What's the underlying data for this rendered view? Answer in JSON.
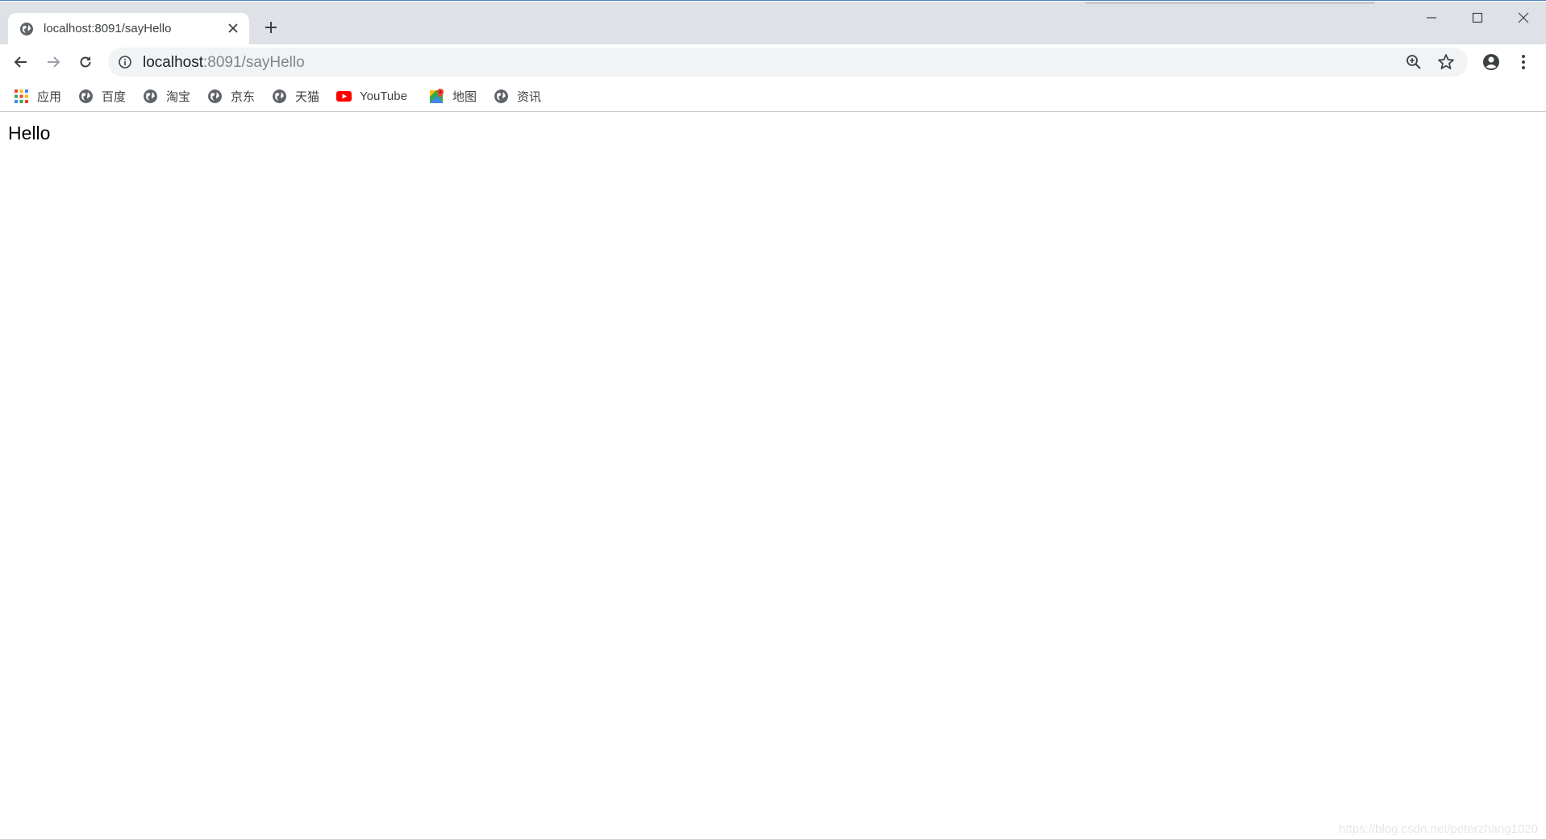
{
  "tab": {
    "title": "localhost:8091/sayHello",
    "favicon": "globe-icon"
  },
  "toolbar": {
    "url_host": "localhost",
    "url_path": ":8091/sayHello"
  },
  "bookmarks": [
    {
      "label": "应用",
      "icon": "apps-grid-icon"
    },
    {
      "label": "百度",
      "icon": "globe-icon"
    },
    {
      "label": "淘宝",
      "icon": "globe-icon"
    },
    {
      "label": "京东",
      "icon": "globe-icon"
    },
    {
      "label": "天猫",
      "icon": "globe-icon"
    },
    {
      "label": "YouTube",
      "icon": "youtube-icon"
    },
    {
      "label": "地图",
      "icon": "maps-icon"
    },
    {
      "label": "资讯",
      "icon": "globe-icon"
    }
  ],
  "page": {
    "body_text": "Hello",
    "watermark": "https://blog.csdn.net/peterzhang1020"
  },
  "colors": {
    "tabstrip": "#dee1e6",
    "omnibox": "#f1f3f4",
    "youtube_red": "#ff0000"
  }
}
